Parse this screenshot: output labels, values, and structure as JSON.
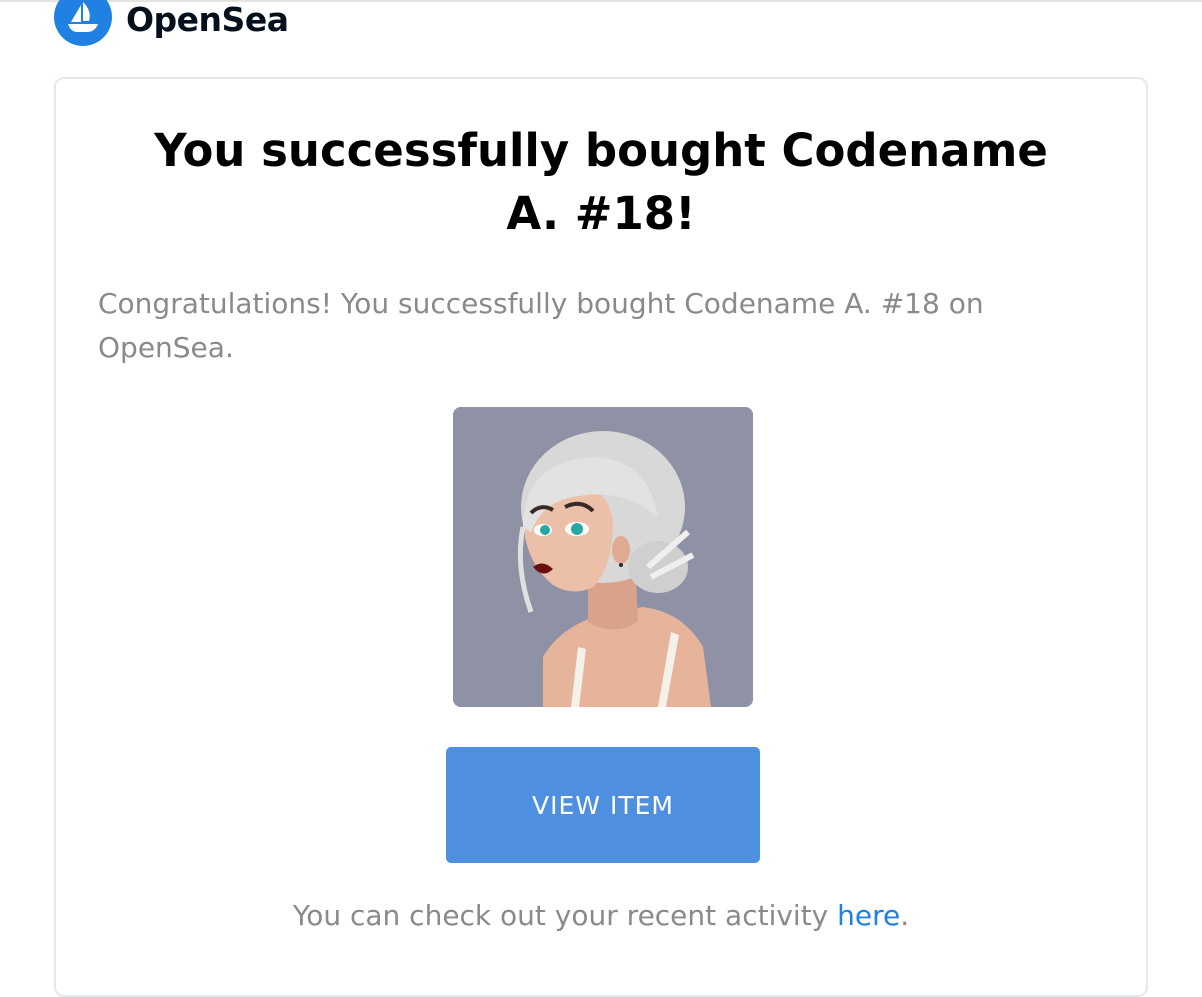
{
  "header": {
    "brand": "OpenSea",
    "logo_icon": "opensea-boat-icon"
  },
  "email": {
    "title": "You successfully bought Codename A. #18!",
    "description": "Congratulations! You successfully bought Codename A. #18 on OpenSea.",
    "image_alt": "white-haired-woman-portrait",
    "button_label": "VIEW ITEM",
    "activity_prefix": "You can check out your recent activity ",
    "activity_link": "here",
    "activity_suffix": "."
  },
  "colors": {
    "brand_blue": "#2081e2",
    "button_blue": "#4f8fe0",
    "muted_text": "#8a8a8a",
    "card_border": "#e5e8eb"
  }
}
